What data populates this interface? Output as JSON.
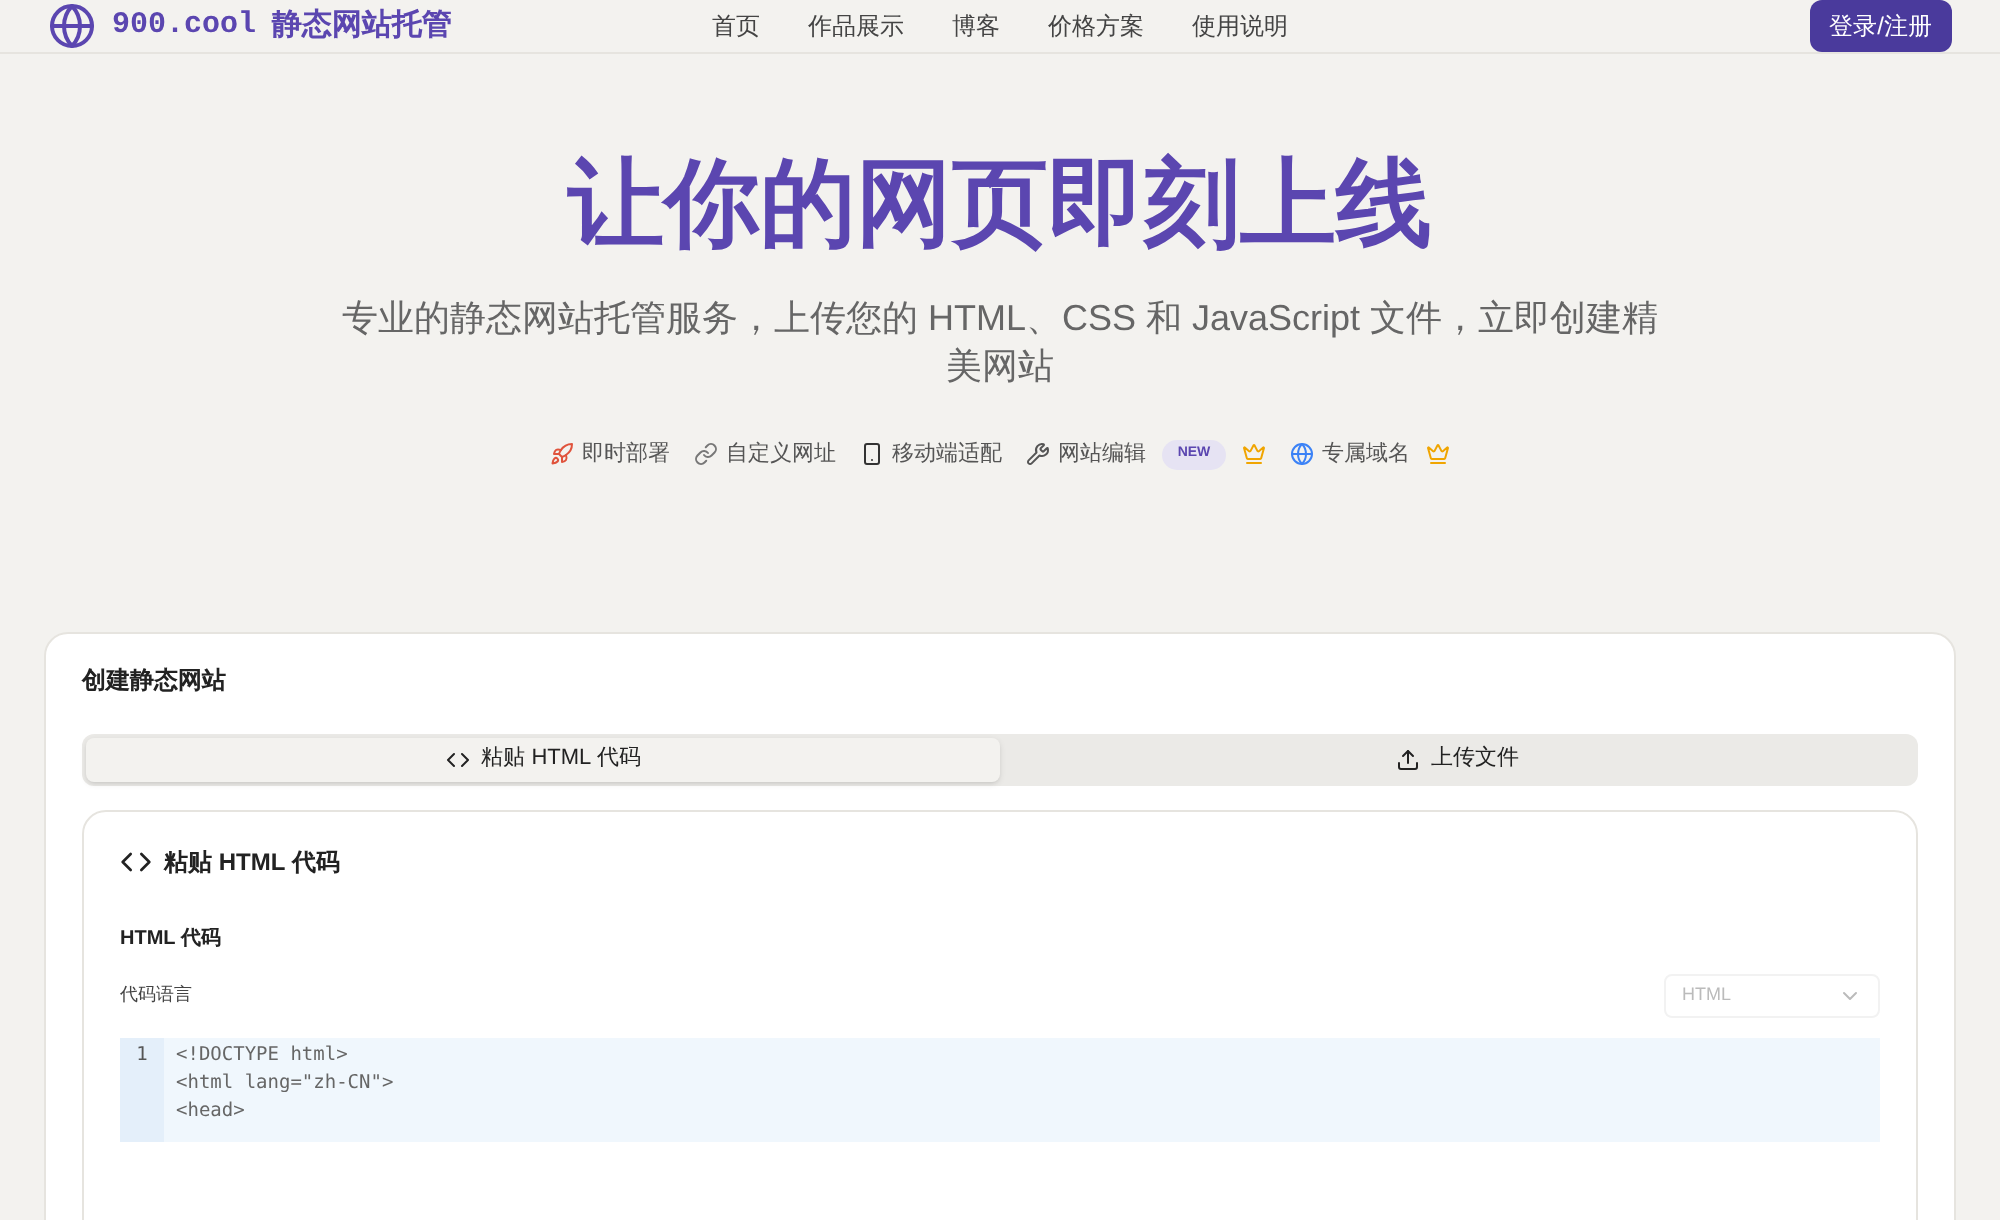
{
  "header": {
    "logo": "900.cool",
    "site_name": "静态网站托管",
    "nav": [
      "首页",
      "作品展示",
      "博客",
      "价格方案",
      "使用说明"
    ],
    "login_button": "登录/注册"
  },
  "hero": {
    "title": "让你的网页即刻上线",
    "subtitle": "专业的静态网站托管服务，上传您的 HTML、CSS 和 JavaScript 文件，立即创建精美网站",
    "features": [
      {
        "label": "即时部署",
        "premium": false
      },
      {
        "label": "自定义网址",
        "premium": false
      },
      {
        "label": "移动端适配",
        "premium": false
      },
      {
        "label": "网站编辑",
        "badge": "NEW",
        "premium": true
      },
      {
        "label": "专属域名",
        "premium": true
      }
    ]
  },
  "create_card": {
    "title": "创建静态网站",
    "tabs": [
      {
        "label": "粘贴 HTML 代码",
        "selected": true
      },
      {
        "label": "上传文件",
        "selected": false
      }
    ],
    "panel": {
      "title": "粘贴 HTML 代码",
      "section_label": "HTML 代码",
      "language_label": "代码语言",
      "language_select": "HTML",
      "line_numbers": [
        "1"
      ],
      "code_lines": [
        "<!DOCTYPE html>",
        "<html lang=\"zh-CN\">",
        "<head>"
      ]
    }
  }
}
